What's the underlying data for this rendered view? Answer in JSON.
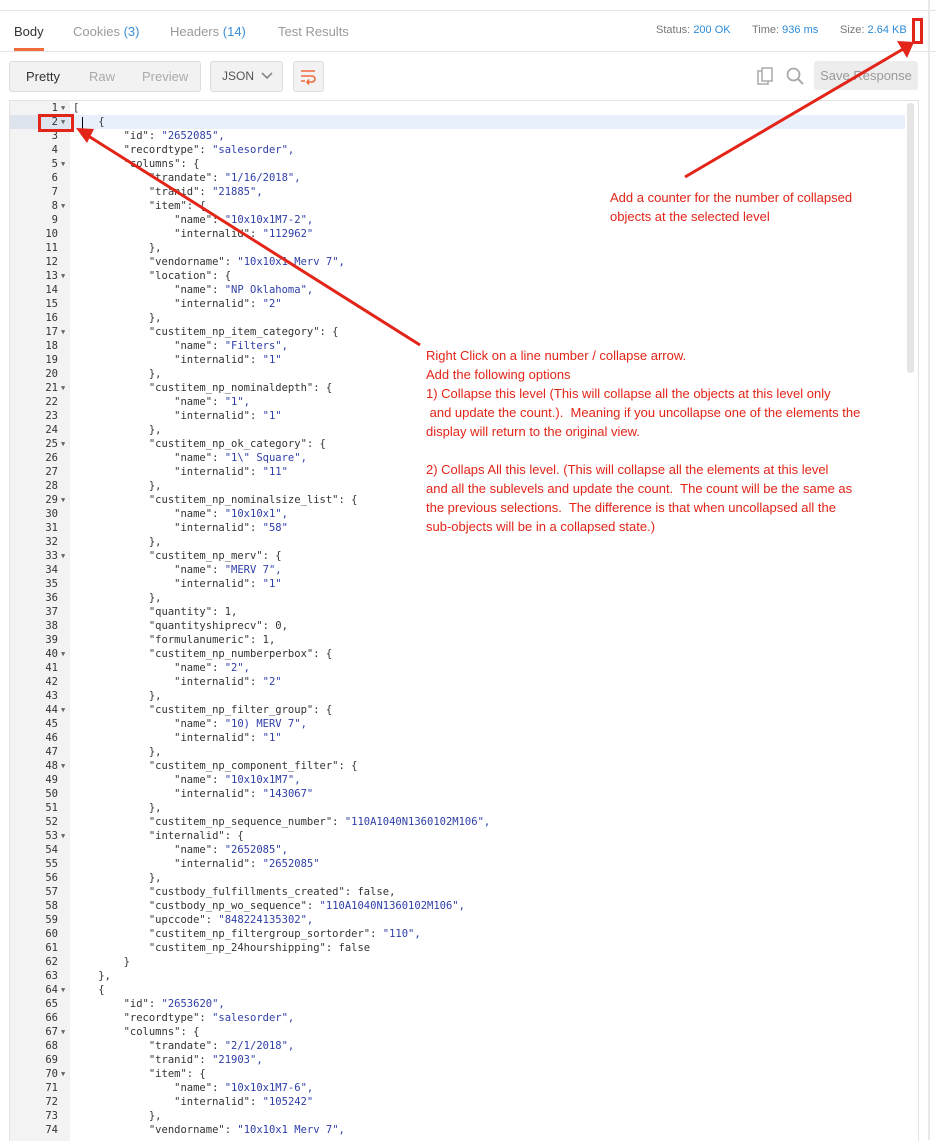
{
  "tabs": [
    {
      "label": "Body",
      "count": ""
    },
    {
      "label": "Cookies",
      "count": "(3)"
    },
    {
      "label": "Headers",
      "count": "(14)"
    },
    {
      "label": "Test Results",
      "count": ""
    }
  ],
  "status": {
    "label": "Status:",
    "value": "200 OK"
  },
  "time": {
    "label": "Time:",
    "value": "936 ms"
  },
  "size": {
    "label": "Size:",
    "value": "2.64 KB"
  },
  "view_modes": [
    "Pretty",
    "Raw",
    "Preview"
  ],
  "format": "JSON",
  "save_label": "Save Response",
  "colors": {
    "accent": "#f26b3a",
    "link": "#2d8bd8",
    "annotation": "#e32418",
    "string": "#2e3ea8"
  },
  "code_lines": [
    {
      "n": "1",
      "f": true,
      "t": "["
    },
    {
      "n": "2",
      "f": true,
      "t": "    {"
    },
    {
      "n": "3",
      "f": false,
      "t": "        \"id\": \"2652085\","
    },
    {
      "n": "4",
      "f": false,
      "t": "        \"recordtype\": \"salesorder\","
    },
    {
      "n": "5",
      "f": true,
      "t": "        \"columns\": {"
    },
    {
      "n": "6",
      "f": false,
      "t": "            \"trandate\": \"1/16/2018\","
    },
    {
      "n": "7",
      "f": false,
      "t": "            \"tranid\": \"21885\","
    },
    {
      "n": "8",
      "f": true,
      "t": "            \"item\": {"
    },
    {
      "n": "9",
      "f": false,
      "t": "                \"name\": \"10x10x1M7-2\","
    },
    {
      "n": "10",
      "f": false,
      "t": "                \"internalid\": \"112962\""
    },
    {
      "n": "11",
      "f": false,
      "t": "            },"
    },
    {
      "n": "12",
      "f": false,
      "t": "            \"vendorname\": \"10x10x1 Merv 7\","
    },
    {
      "n": "13",
      "f": true,
      "t": "            \"location\": {"
    },
    {
      "n": "14",
      "f": false,
      "t": "                \"name\": \"NP Oklahoma\","
    },
    {
      "n": "15",
      "f": false,
      "t": "                \"internalid\": \"2\""
    },
    {
      "n": "16",
      "f": false,
      "t": "            },"
    },
    {
      "n": "17",
      "f": true,
      "t": "            \"custitem_np_item_category\": {"
    },
    {
      "n": "18",
      "f": false,
      "t": "                \"name\": \"Filters\","
    },
    {
      "n": "19",
      "f": false,
      "t": "                \"internalid\": \"1\""
    },
    {
      "n": "20",
      "f": false,
      "t": "            },"
    },
    {
      "n": "21",
      "f": true,
      "t": "            \"custitem_np_nominaldepth\": {"
    },
    {
      "n": "22",
      "f": false,
      "t": "                \"name\": \"1\","
    },
    {
      "n": "23",
      "f": false,
      "t": "                \"internalid\": \"1\""
    },
    {
      "n": "24",
      "f": false,
      "t": "            },"
    },
    {
      "n": "25",
      "f": true,
      "t": "            \"custitem_np_ok_category\": {"
    },
    {
      "n": "26",
      "f": false,
      "t": "                \"name\": \"1\\\" Square\","
    },
    {
      "n": "27",
      "f": false,
      "t": "                \"internalid\": \"11\""
    },
    {
      "n": "28",
      "f": false,
      "t": "            },"
    },
    {
      "n": "29",
      "f": true,
      "t": "            \"custitem_np_nominalsize_list\": {"
    },
    {
      "n": "30",
      "f": false,
      "t": "                \"name\": \"10x10x1\","
    },
    {
      "n": "31",
      "f": false,
      "t": "                \"internalid\": \"58\""
    },
    {
      "n": "32",
      "f": false,
      "t": "            },"
    },
    {
      "n": "33",
      "f": true,
      "t": "            \"custitem_np_merv\": {"
    },
    {
      "n": "34",
      "f": false,
      "t": "                \"name\": \"MERV 7\","
    },
    {
      "n": "35",
      "f": false,
      "t": "                \"internalid\": \"1\""
    },
    {
      "n": "36",
      "f": false,
      "t": "            },"
    },
    {
      "n": "37",
      "f": false,
      "t": "            \"quantity\": 1,"
    },
    {
      "n": "38",
      "f": false,
      "t": "            \"quantityshiprecv\": 0,"
    },
    {
      "n": "39",
      "f": false,
      "t": "            \"formulanumeric\": 1,"
    },
    {
      "n": "40",
      "f": true,
      "t": "            \"custitem_np_numberperbox\": {"
    },
    {
      "n": "41",
      "f": false,
      "t": "                \"name\": \"2\","
    },
    {
      "n": "42",
      "f": false,
      "t": "                \"internalid\": \"2\""
    },
    {
      "n": "43",
      "f": false,
      "t": "            },"
    },
    {
      "n": "44",
      "f": true,
      "t": "            \"custitem_np_filter_group\": {"
    },
    {
      "n": "45",
      "f": false,
      "t": "                \"name\": \"10) MERV 7\","
    },
    {
      "n": "46",
      "f": false,
      "t": "                \"internalid\": \"1\""
    },
    {
      "n": "47",
      "f": false,
      "t": "            },"
    },
    {
      "n": "48",
      "f": true,
      "t": "            \"custitem_np_component_filter\": {"
    },
    {
      "n": "49",
      "f": false,
      "t": "                \"name\": \"10x10x1M7\","
    },
    {
      "n": "50",
      "f": false,
      "t": "                \"internalid\": \"143067\""
    },
    {
      "n": "51",
      "f": false,
      "t": "            },"
    },
    {
      "n": "52",
      "f": false,
      "t": "            \"custitem_np_sequence_number\": \"110A1040N1360102M106\","
    },
    {
      "n": "53",
      "f": true,
      "t": "            \"internalid\": {"
    },
    {
      "n": "54",
      "f": false,
      "t": "                \"name\": \"2652085\","
    },
    {
      "n": "55",
      "f": false,
      "t": "                \"internalid\": \"2652085\""
    },
    {
      "n": "56",
      "f": false,
      "t": "            },"
    },
    {
      "n": "57",
      "f": false,
      "t": "            \"custbody_fulfillments_created\": false,"
    },
    {
      "n": "58",
      "f": false,
      "t": "            \"custbody_np_wo_sequence\": \"110A1040N1360102M106\","
    },
    {
      "n": "59",
      "f": false,
      "t": "            \"upccode\": \"848224135302\","
    },
    {
      "n": "60",
      "f": false,
      "t": "            \"custitem_np_filtergroup_sortorder\": \"110\","
    },
    {
      "n": "61",
      "f": false,
      "t": "            \"custitem_np_24hourshipping\": false"
    },
    {
      "n": "62",
      "f": false,
      "t": "        }"
    },
    {
      "n": "63",
      "f": false,
      "t": "    },"
    },
    {
      "n": "64",
      "f": true,
      "t": "    {"
    },
    {
      "n": "65",
      "f": false,
      "t": "        \"id\": \"2653620\","
    },
    {
      "n": "66",
      "f": false,
      "t": "        \"recordtype\": \"salesorder\","
    },
    {
      "n": "67",
      "f": true,
      "t": "        \"columns\": {"
    },
    {
      "n": "68",
      "f": false,
      "t": "            \"trandate\": \"2/1/2018\","
    },
    {
      "n": "69",
      "f": false,
      "t": "            \"tranid\": \"21903\","
    },
    {
      "n": "70",
      "f": true,
      "t": "            \"item\": {"
    },
    {
      "n": "71",
      "f": false,
      "t": "                \"name\": \"10x10x1M7-6\","
    },
    {
      "n": "72",
      "f": false,
      "t": "                \"internalid\": \"105242\""
    },
    {
      "n": "73",
      "f": false,
      "t": "            },"
    },
    {
      "n": "74",
      "f": false,
      "t": "            \"vendorname\": \"10x10x1 Merv 7\","
    }
  ],
  "annotations": {
    "counter_note": "Add a counter for the number of collapsed\nobjects at the selected level",
    "context_note": "Right Click on a line number / collapse arrow.\nAdd the following options\n1) Collapse this level (This will collapse all the objects at this level only\n and update the count.).  Meaning if you uncollapse one of the elements the\ndisplay will return to the original view.\n\n2) Collaps All this level. (This will collapse all the elements at this level\nand all the sublevels and update the count.  The count will be the same as\nthe previous selections.  The difference is that when uncollapsed all the\nsub-objects will be in a collapsed state.)"
  }
}
